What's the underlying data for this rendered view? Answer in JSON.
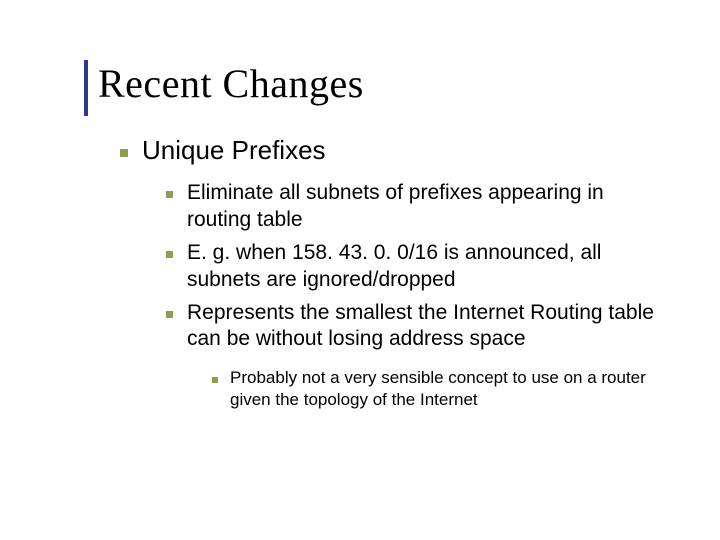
{
  "title": "Recent Changes",
  "bullets": {
    "l1": {
      "text": "Unique Prefixes",
      "children": [
        {
          "text": "Eliminate all subnets of prefixes appearing in routing table"
        },
        {
          "text": "E. g. when 158. 43. 0. 0/16 is announced, all subnets are ignored/dropped"
        },
        {
          "text": "Represents the smallest the Internet Routing table can be without losing address space",
          "children": [
            {
              "text": "Probably not a very sensible concept to use on a router given the topology of the Internet"
            }
          ]
        }
      ]
    }
  },
  "colors": {
    "accent_bar": "#2a3a8a",
    "bullet": "#8aa050"
  }
}
